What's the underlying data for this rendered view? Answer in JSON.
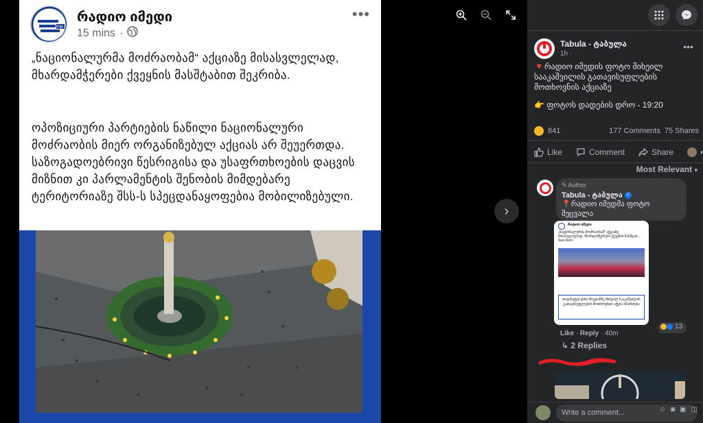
{
  "post": {
    "page_name": "რადიო იმედი",
    "time": "15 mins",
    "dot": "·",
    "more": "•••",
    "text_1": "„ნაციონალურმა მოძრაობამ“ აქციაზე მისასვლელად, მხარდამჭერები ქვეყნის მასშტაბით შეკრიბა.",
    "text_2": "ოპოზიციური პარტიების ნაწილი ნაციონალური მოძრაობის მიერ ორგანიზებულ აქციას არ შეუერთდა. საზოგადოებრივი წესრიგისა და უსაფრთხოების დაცვის მიზნით კი პარლამენტის შენობის მიმდებარე ტერიტორიაზე შსს-ს სპეცდანაყოფებია მობილიზებული.",
    "logo_badge": "FM"
  },
  "viewer": {
    "zoom_in_icon": "zoom-in-icon",
    "zoom_out_icon": "zoom-out-icon",
    "fullscreen_icon": "fullscreen-icon",
    "next_arrow": "›"
  },
  "sidebar": {
    "poster_name": "Tabula - ტაბულა",
    "poster_time": "1h ·",
    "more": "•••",
    "text_1": "🔻რადიო იმედის ფოტო მიხეილ სააკაშვილის გათავისუფლების მოთხოვნის აქციაზე",
    "text_2": "👉 ფოტოს დადების დრო - 19:20",
    "reaction_count": "841",
    "comments_count": "177 Comments",
    "shares_count": "75 Shares",
    "like_label": "Like",
    "comment_label": "Comment",
    "share_label": "Share",
    "sort_label": "Most Relevant",
    "comment": {
      "author_badge": "Author",
      "name": "Tabula - ტაბულა",
      "text": "📍რადიო იმედმა ფოტო შეცვალა",
      "thumb_name": "რადიო იმედი",
      "thumb_text": "„ნაციონალურმა მოძრაობამ“ აქციაზე მისასვლელად, მხარდამჭერები ქვეყნის მასშტაბ... See more",
      "thumb_caption": "თავისუფლების მოედანზე მიხეილ სააკაშვილის გათავისუფლების მოთხოვნით აქცია იმართება",
      "reaction_count": "13",
      "like": "Like",
      "reply": "Reply",
      "time": "40m",
      "replies": "2 Replies"
    },
    "write_placeholder": "Write a comment..."
  },
  "colors": {
    "brand_red": "#e41e26",
    "fb_blue": "#1877f2",
    "frame_blue": "#1a47a8",
    "sidebar_bg": "#242526"
  }
}
